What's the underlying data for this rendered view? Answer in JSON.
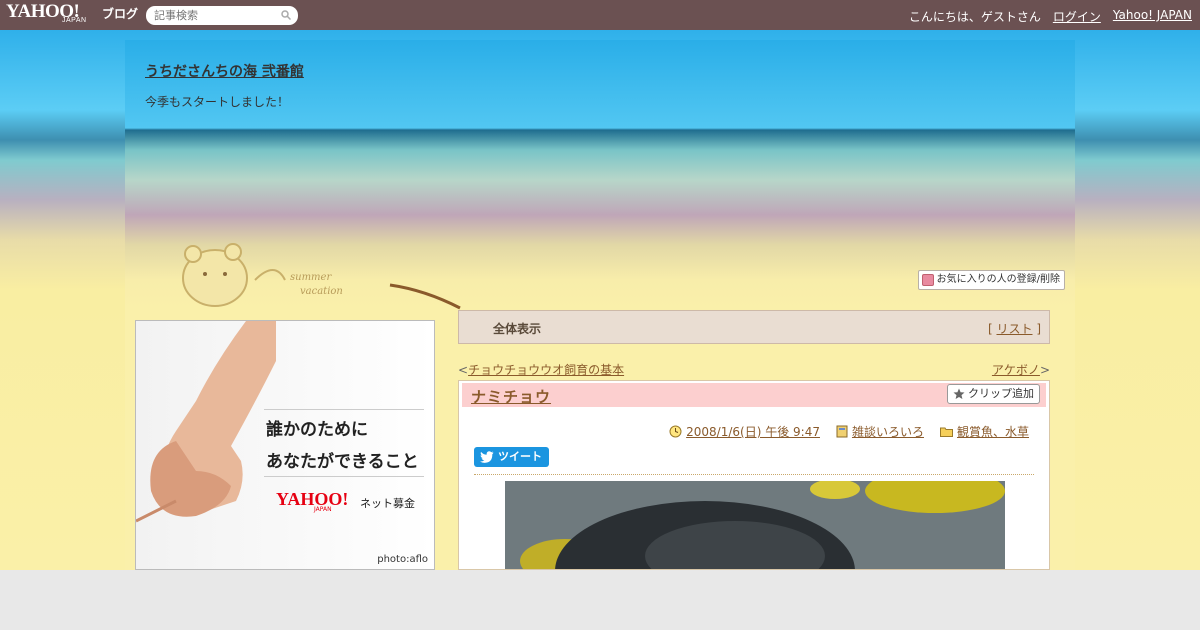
{
  "topbar": {
    "logo": "YAHOO!",
    "logo_sub": "JAPAN",
    "blog_label": "ブログ",
    "search_placeholder": "記事検索",
    "greeting": "こんにちは、ゲストさん",
    "login": "ログイン",
    "yahoo_japan": "Yahoo! JAPAN"
  },
  "blog": {
    "title": "うちださんちの海 弐番館",
    "description": "今季もスタートしました！",
    "favorite_button": "お気に入りの人の登録/削除"
  },
  "ad": {
    "line1": "誰かのために",
    "line2": "あなたができること",
    "logo": "YAHOO!",
    "logo_sub": "JAPAN",
    "text": "ネット募金",
    "credit": "photo:aflo"
  },
  "nav": {
    "all": "全体表示",
    "list": "リスト",
    "prev": "チョウチョウウオ飼育の基本",
    "next": "アケボノ"
  },
  "article": {
    "title": "ナミチョウ",
    "clip_button": "クリップ追加",
    "date": "2008/1/6(日) 午後 9:47",
    "category1": "雑談いろいろ",
    "category2": "観賞魚、水草",
    "tweet": "ツイート"
  },
  "colors": {
    "topbar": "#6b5152",
    "accent_link": "#8a5a2b",
    "article_head": "#fccfcf",
    "tweet": "#1b95e0"
  }
}
